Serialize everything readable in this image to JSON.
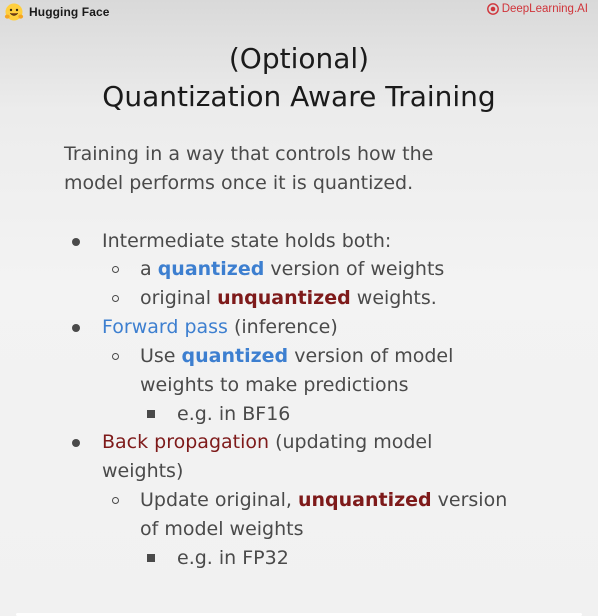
{
  "header": {
    "left_brand": "Hugging Face",
    "right_brand": "DeepLearning.AI"
  },
  "slide": {
    "title_line1": "(Optional)",
    "title_line2": "Quantization Aware Training",
    "subtitle_line1": "Training in a way that controls how the",
    "subtitle_line2": "model performs once it is quantized.",
    "bullets": {
      "b1": "Intermediate state holds both:",
      "b1a_pre": "a ",
      "b1a_em": "quantized",
      "b1a_post": " version of weights",
      "b1b_pre": "original ",
      "b1b_em": "unquantized",
      "b1b_post": " weights.",
      "b2_em": "Forward pass",
      "b2_post": " (inference)",
      "b2a_pre": "Use ",
      "b2a_em": "quantized",
      "b2a_post": " version of model",
      "b2a_line2": "weights to make predictions",
      "b2a_i": "e.g. in BF16",
      "b3_em": "Back propagation",
      "b3_post": " (updating model",
      "b3_line2": "weights)",
      "b3a_pre": "Update original, ",
      "b3a_em": "unquantized",
      "b3a_post": " version",
      "b3a_line2": "of model weights",
      "b3a_i": "e.g. in FP32"
    }
  },
  "colors": {
    "quantized_accent": "#3d7fd0",
    "unquantized_accent": "#7e1a1a",
    "brand_right": "#d0343a"
  },
  "icons": {
    "left_logo": "hugging-face-emoji-icon",
    "right_logo": "deeplearning-ai-logo-icon"
  }
}
